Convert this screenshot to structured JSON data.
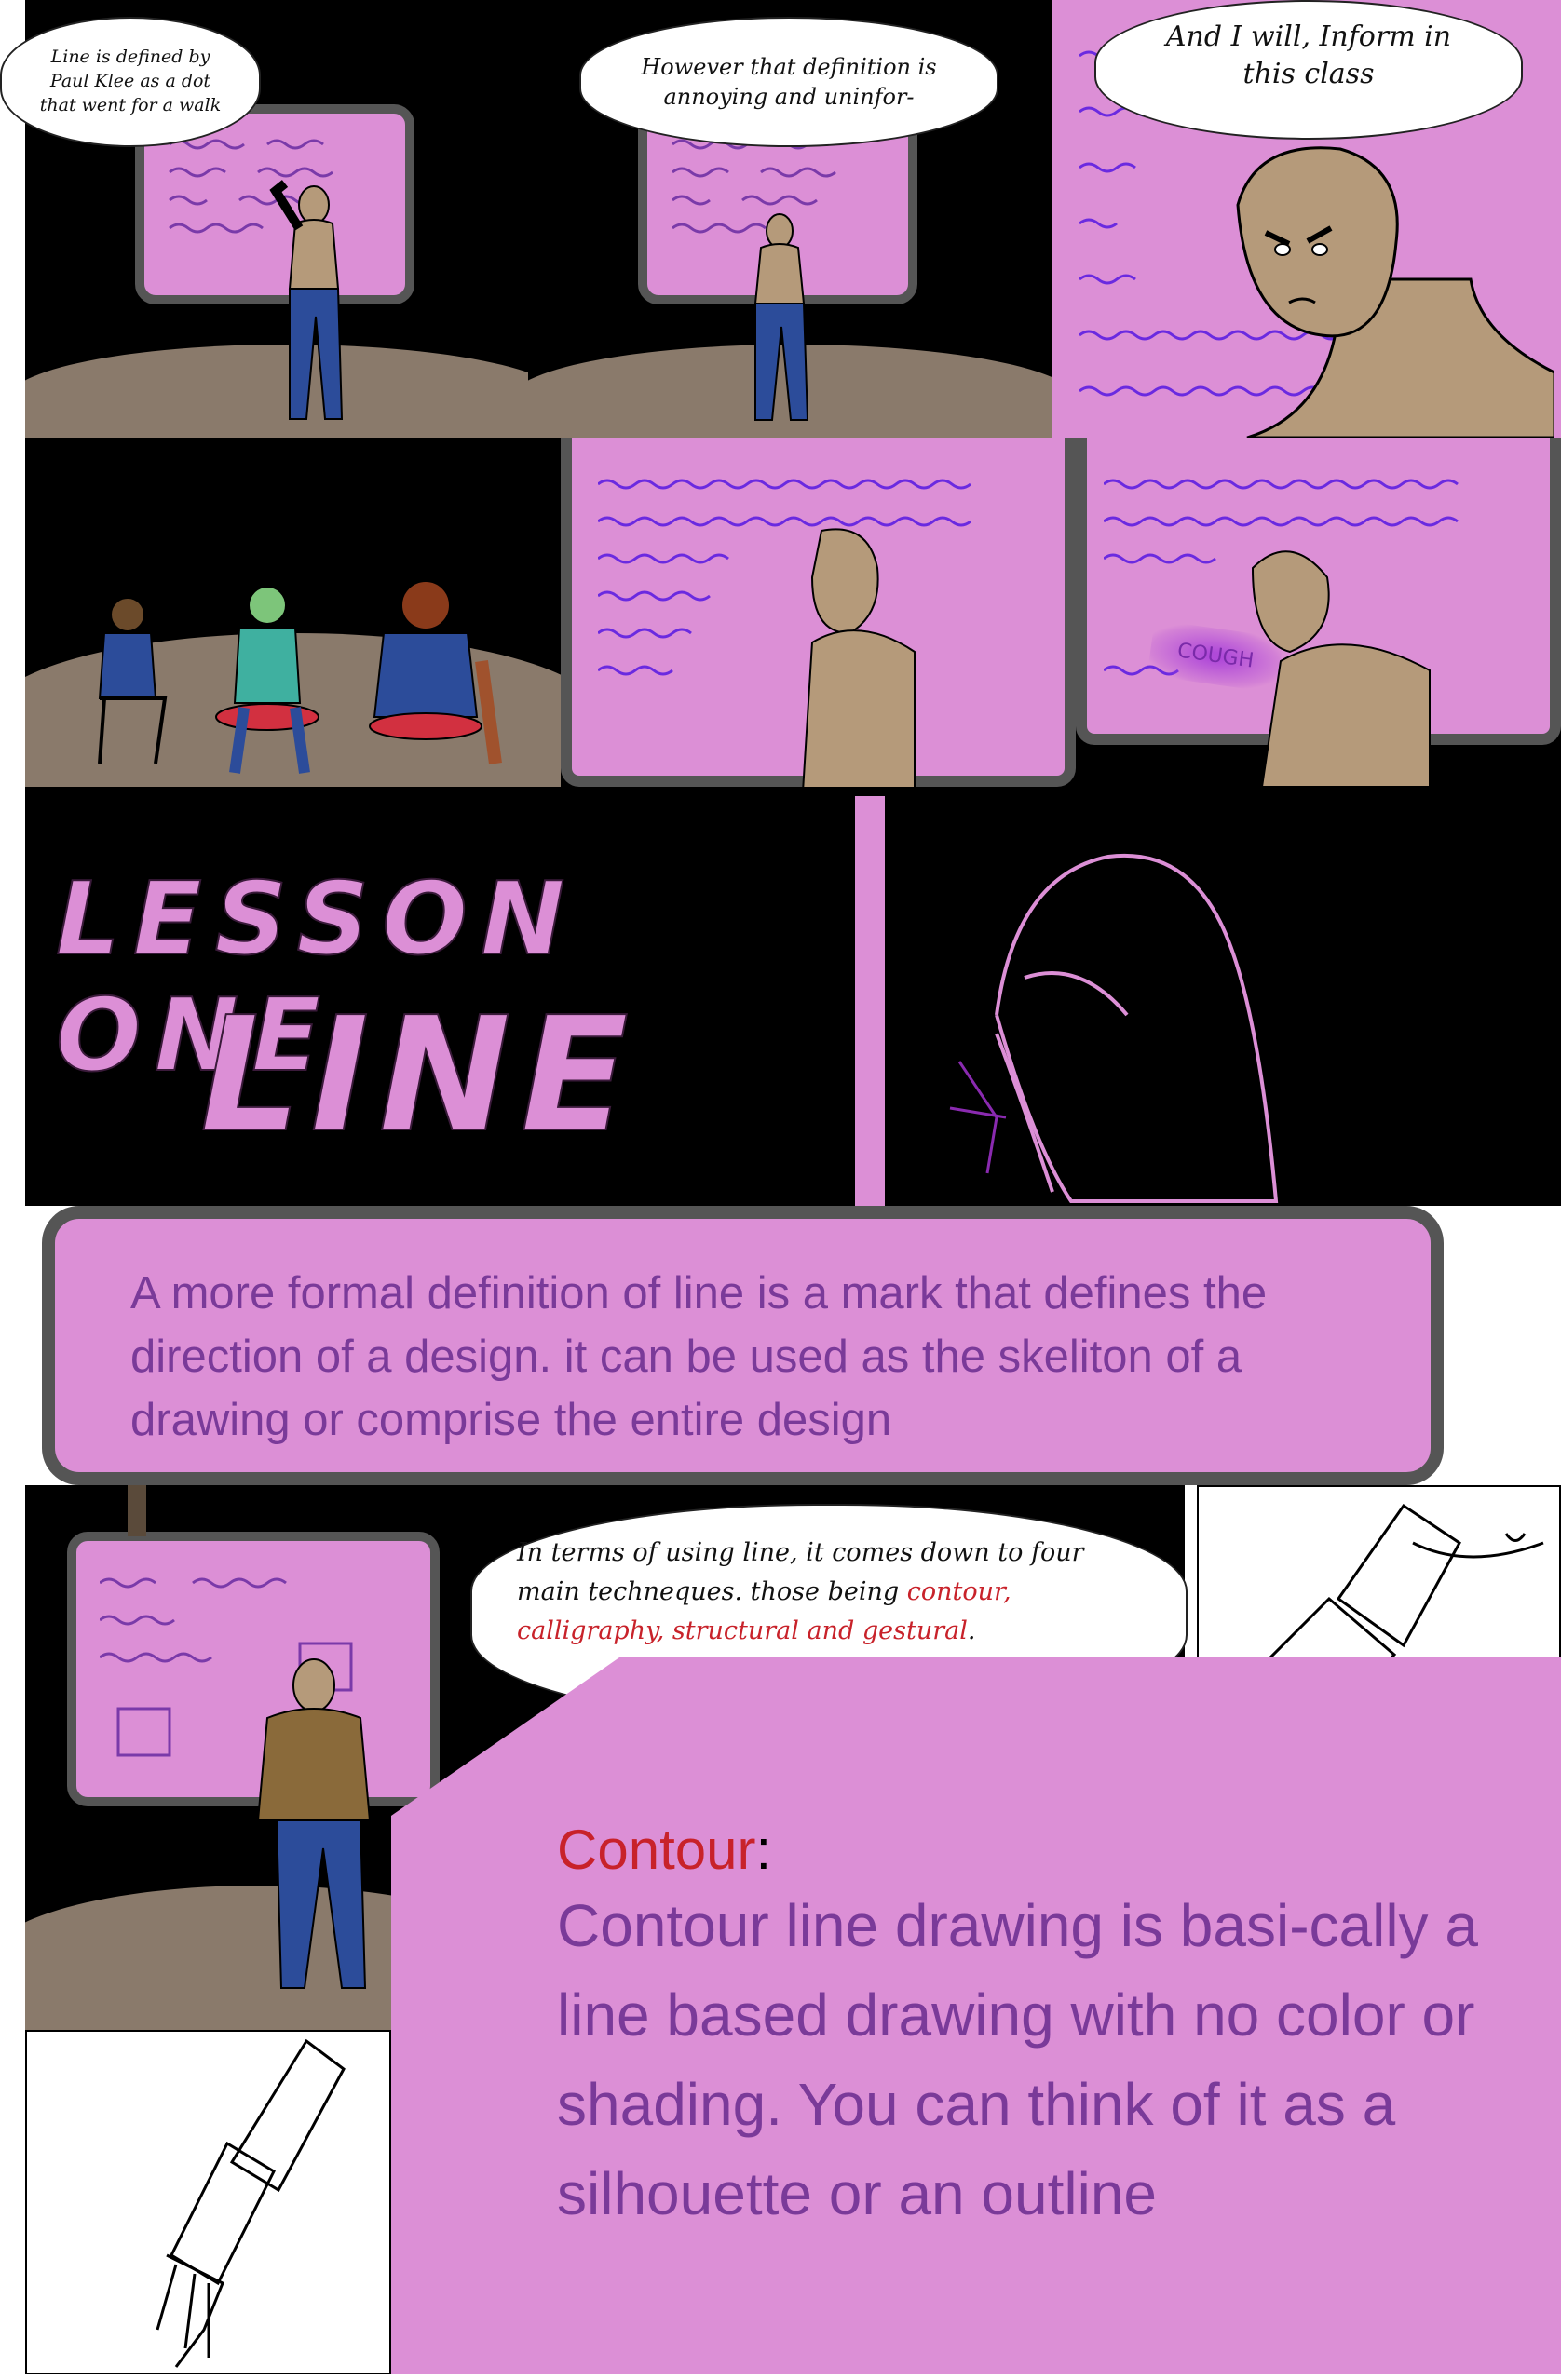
{
  "panel1": {
    "speech": "Line is defined by Paul Klee as a dot that went for a walk"
  },
  "panel2": {
    "speech": "However that definition is annoying and uninfor-"
  },
  "panel3": {
    "speech": "And I will, Inform in this class"
  },
  "panel6": {
    "sfx": "COUGH"
  },
  "title": {
    "line1": "LESSON ONE",
    "line2": "LINE"
  },
  "definition_box": {
    "text": "A more formal definition of line is a mark that defines the direction of a design. it can be used as the skeliton of a drawing or comprise the entire design"
  },
  "panel8": {
    "speech_lead": "In terms of using line, it  comes down to four main techneques. those being",
    "speech_highlight": "contour, calligraphy, structural and gestural",
    "speech_end": "."
  },
  "contour": {
    "heading": "Contour",
    "colon": ":",
    "body": "Contour line drawing is basi-cally a line based drawing with no color or shading. You can think of it as a silhouette or an outline"
  },
  "colors": {
    "pink": "#dc8fd6",
    "purple_text": "#7a3a99",
    "red_heading": "#c8222a",
    "frame_gray": "#555555"
  }
}
